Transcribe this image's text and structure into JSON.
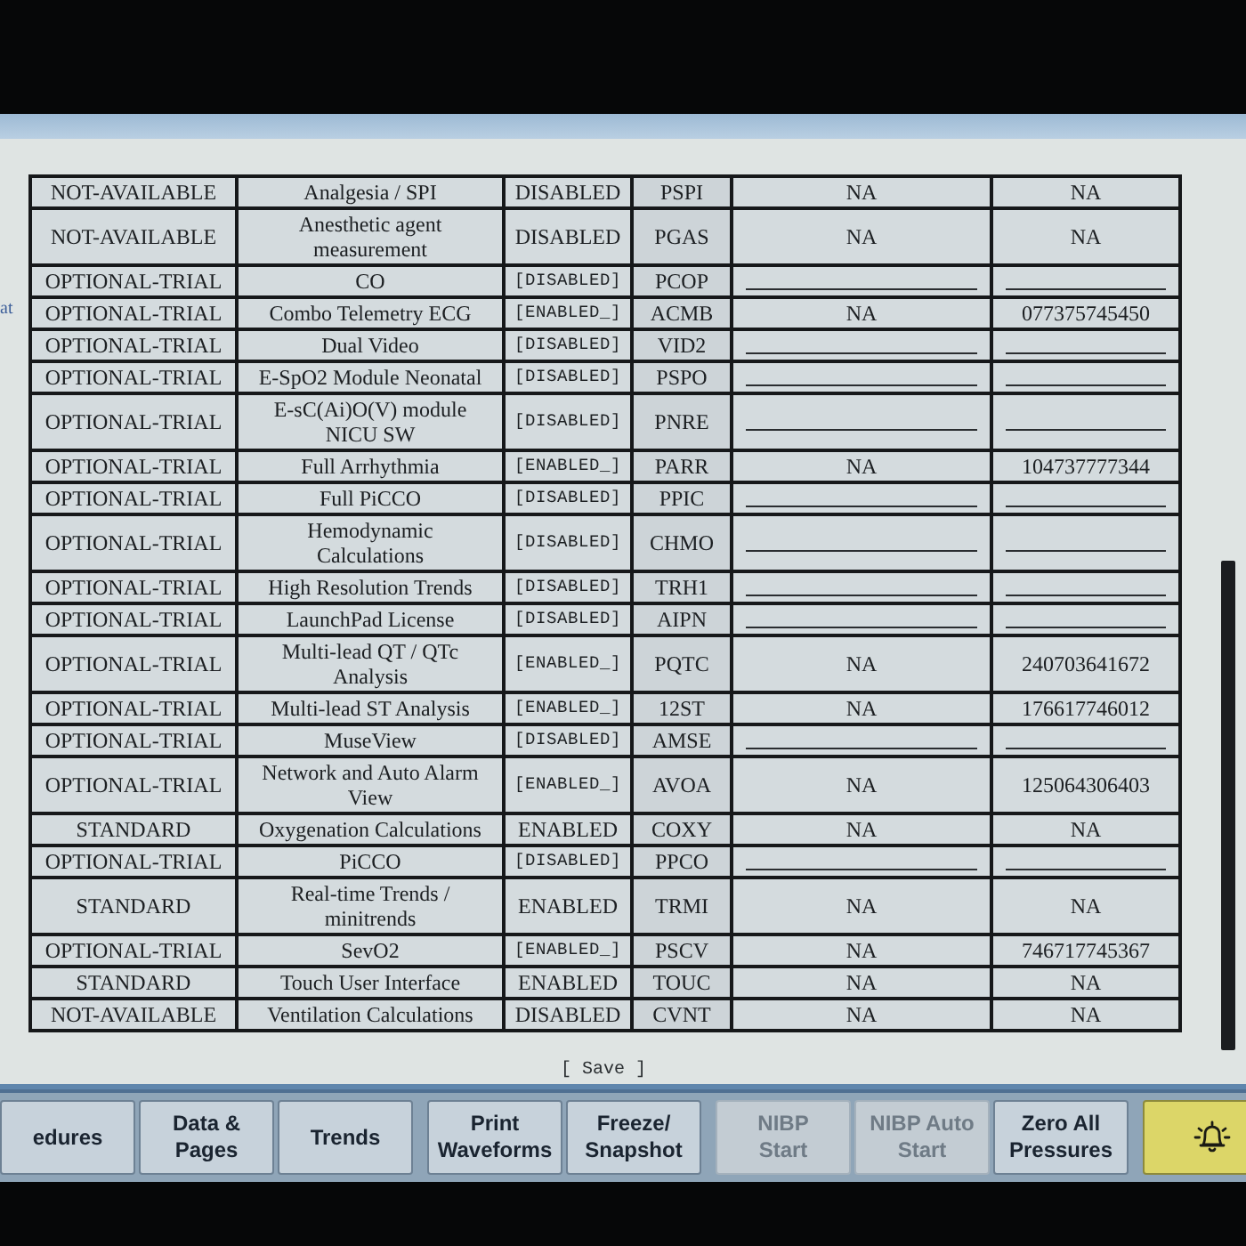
{
  "left_edge_fragment": "at",
  "table": {
    "rows": [
      {
        "kind": "fixed",
        "column_1": "NOT-AVAILABLE",
        "column_2": "Analgesia / SPI",
        "column_3": "DISABLED",
        "column_4": "PSPI",
        "column_5": "NA",
        "column_6": "NA"
      },
      {
        "kind": "fixed",
        "column_1": "NOT-AVAILABLE",
        "column_2": "Anesthetic agent\nmeasurement",
        "column_3": "DISABLED",
        "column_4": "PGAS",
        "column_5": "NA",
        "column_6": "NA"
      },
      {
        "kind": "trial",
        "column_1": "OPTIONAL-TRIAL",
        "column_2": "CO",
        "column_3": "[DISABLED]",
        "column_4": "PCOP"
      },
      {
        "kind": "trial",
        "column_1": "OPTIONAL-TRIAL",
        "column_2": "Combo Telemetry ECG",
        "column_3": "[ENABLED_]",
        "column_4": "ACMB",
        "column_5": "NA",
        "column_6": "077375745450"
      },
      {
        "kind": "trial",
        "column_1": "OPTIONAL-TRIAL",
        "column_2": "Dual Video",
        "column_3": "[DISABLED]",
        "column_4": "VID2"
      },
      {
        "kind": "trial",
        "column_1": "OPTIONAL-TRIAL",
        "column_2": "E-SpO2 Module Neonatal",
        "column_3": "[DISABLED]",
        "column_4": "PSPO"
      },
      {
        "kind": "trial",
        "column_1": "OPTIONAL-TRIAL",
        "column_2": "E-sC(Ai)O(V) module\nNICU SW",
        "column_3": "[DISABLED]",
        "column_4": "PNRE"
      },
      {
        "kind": "trial",
        "column_1": "OPTIONAL-TRIAL",
        "column_2": "Full Arrhythmia",
        "column_3": "[ENABLED_]",
        "column_4": "PARR",
        "column_5": "NA",
        "column_6": "104737777344"
      },
      {
        "kind": "trial",
        "column_1": "OPTIONAL-TRIAL",
        "column_2": "Full PiCCO",
        "column_3": "[DISABLED]",
        "column_4": "PPIC"
      },
      {
        "kind": "trial",
        "column_1": "OPTIONAL-TRIAL",
        "column_2": "Hemodynamic\nCalculations",
        "column_3": "[DISABLED]",
        "column_4": "CHMO"
      },
      {
        "kind": "trial",
        "column_1": "OPTIONAL-TRIAL",
        "column_2": "High Resolution Trends",
        "column_3": "[DISABLED]",
        "column_4": "TRH1"
      },
      {
        "kind": "trial",
        "column_1": "OPTIONAL-TRIAL",
        "column_2": "LaunchPad License",
        "column_3": "[DISABLED]",
        "column_4": "AIPN"
      },
      {
        "kind": "trial",
        "column_1": "OPTIONAL-TRIAL",
        "column_2": "Multi-lead QT / QTc\nAnalysis",
        "column_3": "[ENABLED_]",
        "column_4": "PQTC",
        "column_5": "NA",
        "column_6": "240703641672"
      },
      {
        "kind": "trial",
        "column_1": "OPTIONAL-TRIAL",
        "column_2": "Multi-lead ST Analysis",
        "column_3": "[ENABLED_]",
        "column_4": "12ST",
        "column_5": "NA",
        "column_6": "176617746012"
      },
      {
        "kind": "trial",
        "column_1": "OPTIONAL-TRIAL",
        "column_2": "MuseView",
        "column_3": "[DISABLED]",
        "column_4": "AMSE"
      },
      {
        "kind": "trial",
        "column_1": "OPTIONAL-TRIAL",
        "column_2": "Network and Auto Alarm\nView",
        "column_3": "[ENABLED_]",
        "column_4": "AVOA",
        "column_5": "NA",
        "column_6": "125064306403"
      },
      {
        "kind": "fixed",
        "column_1": "STANDARD",
        "column_2": "Oxygenation Calculations",
        "column_3": "ENABLED",
        "column_4": "COXY",
        "column_5": "NA",
        "column_6": "NA"
      },
      {
        "kind": "trial",
        "column_1": "OPTIONAL-TRIAL",
        "column_2": "PiCCO",
        "column_3": "[DISABLED]",
        "column_4": "PPCO"
      },
      {
        "kind": "fixed",
        "column_1": "STANDARD",
        "column_2": "Real-time Trends /\nminitrends",
        "column_3": "ENABLED",
        "column_4": "TRMI",
        "column_5": "NA",
        "column_6": "NA"
      },
      {
        "kind": "trial",
        "column_1": "OPTIONAL-TRIAL",
        "column_2": "SevO2",
        "column_3": "[ENABLED_]",
        "column_4": "PSCV",
        "column_5": "NA",
        "column_6": "746717745367"
      },
      {
        "kind": "fixed",
        "column_1": "STANDARD",
        "column_2": "Touch User Interface",
        "column_3": "ENABLED",
        "column_4": "TOUC",
        "column_5": "NA",
        "column_6": "NA"
      },
      {
        "kind": "fixed",
        "column_1": "NOT-AVAILABLE",
        "column_2": "Ventilation Calculations",
        "column_3": "DISABLED",
        "column_4": "CVNT",
        "column_5": "NA",
        "column_6": "NA"
      }
    ]
  },
  "save_button": "[ Save ]",
  "softkey_groups": [
    [
      {
        "kind": "text",
        "label": "edures",
        "disabled": false
      },
      {
        "kind": "text",
        "label": "Data &\nPages",
        "disabled": false
      },
      {
        "kind": "text",
        "label": "Trends",
        "disabled": false
      }
    ],
    [
      {
        "kind": "text",
        "label": "Print\nWaveforms",
        "disabled": false
      },
      {
        "kind": "text",
        "label": "Freeze/\nSnapshot",
        "disabled": false
      }
    ],
    [
      {
        "kind": "text",
        "label": "NIBP\nStart",
        "disabled": true
      },
      {
        "kind": "text",
        "label": "NIBP Auto\nStart",
        "disabled": true
      },
      {
        "kind": "text",
        "label": "Zero All\nPressures",
        "disabled": false
      }
    ],
    [
      {
        "kind": "alarm",
        "disabled": false
      }
    ]
  ]
}
